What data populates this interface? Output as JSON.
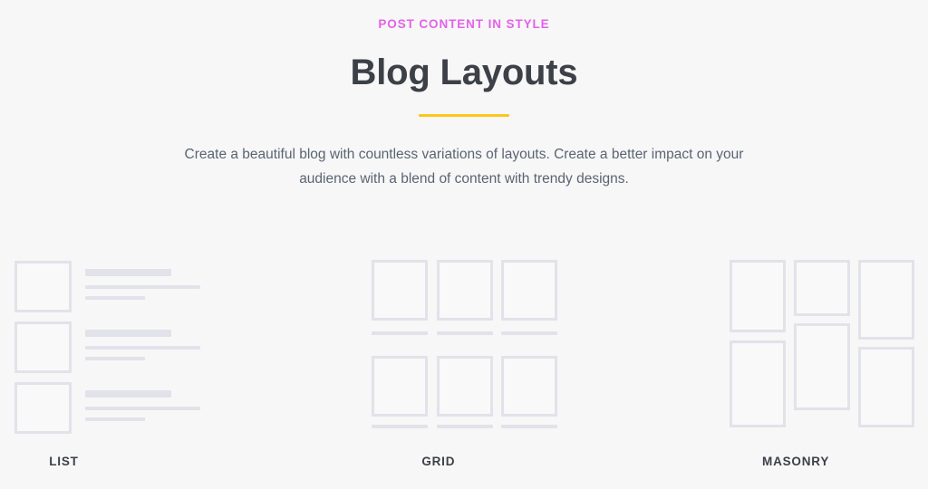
{
  "header": {
    "eyebrow": "POST CONTENT IN STYLE",
    "title": "Blog Layouts",
    "divider_color": "#ffc51c",
    "eyebrow_color": "#e462ea",
    "paragraph": "Create a beautiful blog with countless variations of layouts. Create a better impact on your audience with a blend of content with trendy designs."
  },
  "layouts": [
    {
      "label": "LIST",
      "type": "list",
      "rows": 3,
      "description": "Square thumbnail on the left with three stacked text lines on the right"
    },
    {
      "label": "GRID",
      "type": "grid",
      "columns": 3,
      "rows": 2,
      "description": "Two rows of three equal square cards, each with a caption line beneath"
    },
    {
      "label": "MASONRY",
      "type": "masonry",
      "columns": 3,
      "description": "Three columns of cards with staggered, uneven heights"
    }
  ],
  "colors": {
    "background": "#f7f7f7",
    "placeholder": "#e2e2ea",
    "text_dark": "#3c4047",
    "text_body": "#5a6472"
  }
}
